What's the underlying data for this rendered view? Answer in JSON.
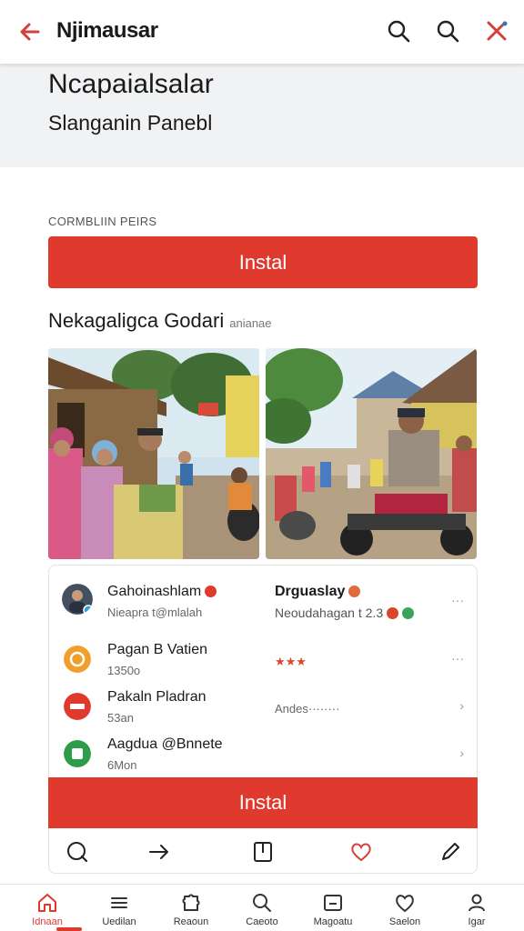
{
  "app_bar": {
    "title": "Njimausar",
    "icons": [
      "back-arrow-icon",
      "search-icon",
      "search-icon",
      "close-icon"
    ]
  },
  "hero": {
    "title": "Ncapaialsalar",
    "subtitle": "Slanganin Panebl"
  },
  "section_label": "CORMBLIIN PEIRS",
  "install_button_top": "Instal",
  "gallery": {
    "title": "Nekagaligca Godari",
    "subtitle": "anianae"
  },
  "list": [
    {
      "name": "Gahoinashlam",
      "meta": "Nieapra t@mlalah",
      "right_name": "Drguaslay",
      "right_meta": "Neoudahagan t 2.3",
      "more": "···"
    },
    {
      "name": "Pagan B Vatien",
      "meta": "1350o",
      "right_tag": "★★★",
      "more": "···"
    },
    {
      "name": "Pakaln Pladran",
      "meta": "53an",
      "right_tag": "Andes········",
      "more": "›"
    },
    {
      "name": "Aagdua @Bnnete",
      "meta": "6Mon",
      "more": "›"
    }
  ],
  "install_button_bottom": "Instal",
  "bottom_nav": [
    {
      "label": "Idnaan",
      "icon": "home-icon"
    },
    {
      "label": "Uedilan",
      "icon": "list-icon"
    },
    {
      "label": "Reaoun",
      "icon": "puzzle-icon"
    },
    {
      "label": "Caeoto",
      "icon": "search-icon"
    },
    {
      "label": "Magoatu",
      "icon": "inbox-icon"
    },
    {
      "label": "Saelon",
      "icon": "heart-icon"
    },
    {
      "label": "Igar",
      "icon": "person-icon"
    }
  ],
  "colors": {
    "accent": "#e03a2f",
    "hero_bg": "#f1f2f4"
  }
}
